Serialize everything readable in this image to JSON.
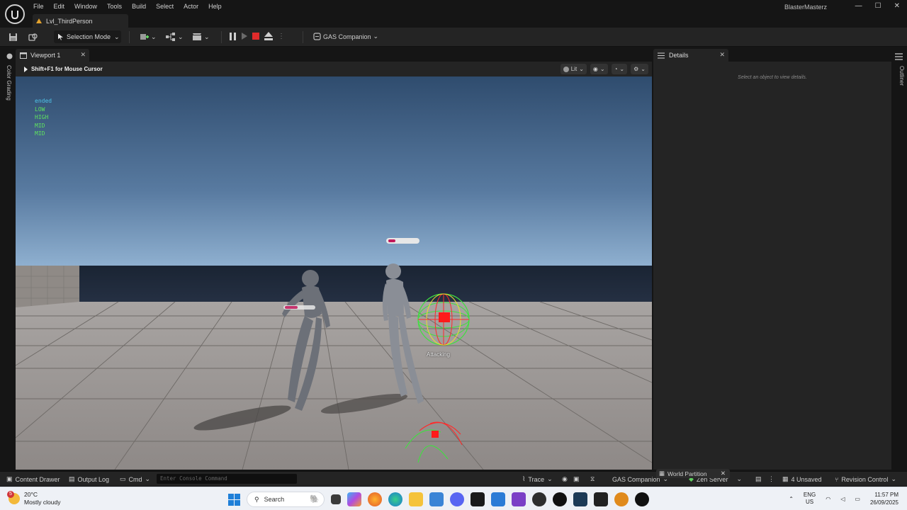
{
  "app": {
    "menu": [
      "File",
      "Edit",
      "Window",
      "Tools",
      "Build",
      "Select",
      "Actor",
      "Help"
    ],
    "project_name": "BlasterMasterz",
    "level_tab": "Lvl_ThirdPerson"
  },
  "toolbar": {
    "mode_label": "Selection Mode",
    "gas_companion_label": "GAS Companion"
  },
  "left_sidebar": {
    "color_grading_label": "Color Grading"
  },
  "right_sidebar": {
    "outliner_label": "Outliner"
  },
  "viewport": {
    "tab_label": "Viewport 1",
    "hint": "Shift+F1 for Mouse Cursor",
    "view_mode": "Lit",
    "debug_lines": [
      {
        "text": "ended",
        "color": "#4fc3e8"
      },
      {
        "text": "LOW",
        "color": "#5fe35f"
      },
      {
        "text": "HIGH",
        "color": "#5fe35f"
      },
      {
        "text": "MID",
        "color": "#5fe35f"
      },
      {
        "text": "MID",
        "color": "#5fe35f"
      }
    ],
    "character_state": "Attacking"
  },
  "details": {
    "tab_label": "Details",
    "empty_message": "Select an object to view details."
  },
  "statusbar": {
    "content_drawer": "Content Drawer",
    "output_log": "Output Log",
    "cmd": "Cmd",
    "console_placeholder": "Enter Console Command",
    "trace": "Trace",
    "gas_companion": "GAS Companion",
    "world_partition": "World Partition",
    "zen_server": "Zen Server",
    "unsaved": "4 Unsaved",
    "revision_control": "Revision Control"
  },
  "taskbar": {
    "weather_badge": "5",
    "temperature": "20°C",
    "weather_desc": "Mostly cloudy",
    "search_label": "Search",
    "lang_line1": "ENG",
    "lang_line2": "US",
    "time": "11:57 PM",
    "date": "26/09/2025"
  },
  "colors": {
    "editor_bg": "#151515",
    "panel_bg": "#242424",
    "stop_red": "#e02b2b",
    "warning_orange": "#e2a22e",
    "sky_top": "#2f4c6e",
    "sky_horizon": "#8fb0d0",
    "floor": "#9a9593"
  }
}
